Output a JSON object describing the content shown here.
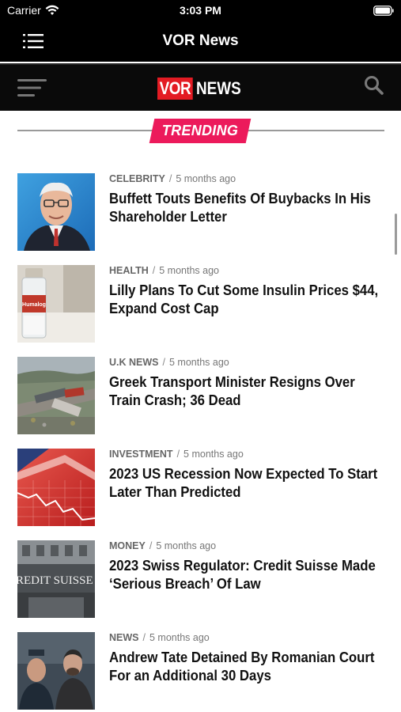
{
  "status_bar": {
    "carrier": "Carrier",
    "time": "3:03 PM"
  },
  "nav": {
    "title": "VOR News"
  },
  "header": {
    "logo_part1": "VOR",
    "logo_part2": "NEWS"
  },
  "trending": {
    "label": "TRENDING"
  },
  "articles": [
    {
      "category": "CELEBRITY",
      "time": "5 months ago",
      "title": "Buffett Touts Benefits Of Buybacks In His Shareholder Letter"
    },
    {
      "category": "HEALTH",
      "time": "5 months ago",
      "title": "Lilly Plans To Cut Some Insulin Prices $44, Expand Cost Cap"
    },
    {
      "category": "U.K NEWS",
      "time": "5 months ago",
      "title": "Greek Transport Minister Resigns Over Train Crash; 36 Dead"
    },
    {
      "category": "INVESTMENT",
      "time": "5 months ago",
      "title": "2023 US Recession Now Expected To Start Later Than Predicted"
    },
    {
      "category": "MONEY",
      "time": "5 months ago",
      "title": "2023 Swiss Regulator: Credit Suisse Made ‘Serious Breach’ Of Law"
    },
    {
      "category": "NEWS",
      "time": "5 months ago",
      "title": "Andrew Tate Detained By Romanian Court For an Additional 30 Days"
    }
  ],
  "thumb_text": {
    "insulin_label": "Humalog",
    "bank_sign": "REDIT SUISSE"
  },
  "colors": {
    "accent_red": "#e31b23",
    "trending_pink": "#ec1a5b",
    "bar_black": "#000000"
  }
}
